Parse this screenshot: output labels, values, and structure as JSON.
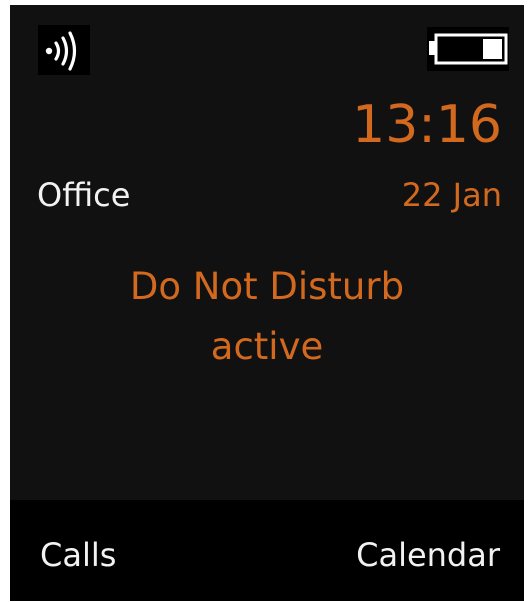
{
  "status_bar": {
    "signal_icon": "wireless-signal-icon",
    "battery_icon": "battery-icon",
    "battery_level": 0.35
  },
  "clock": {
    "time": "13:16",
    "date": "22 Jan"
  },
  "line": {
    "name": "Office"
  },
  "notice": {
    "line1": "Do Not Disturb",
    "line2": "active"
  },
  "softkeys": {
    "left_label": "Calls",
    "right_label": "Calendar"
  },
  "colors": {
    "accent": "#d2691e",
    "text": "#f2f2f2",
    "background": "#111111",
    "softkey_bar": "#000000"
  }
}
